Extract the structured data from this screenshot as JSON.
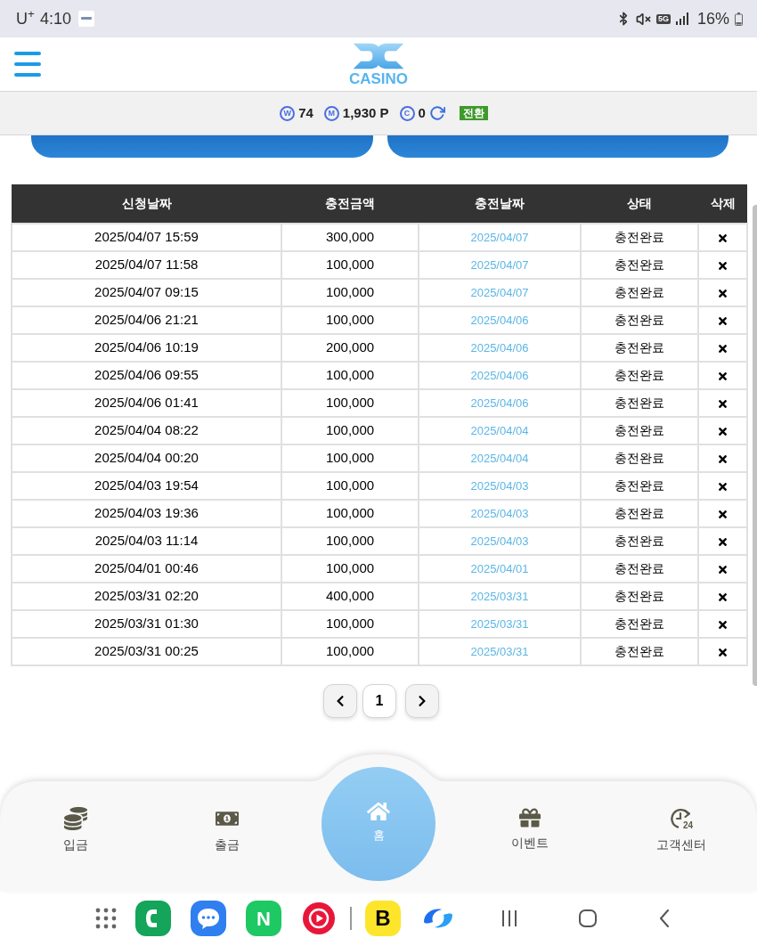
{
  "status_bar": {
    "carrier": "U$^{+}$",
    "time": "4:10",
    "network": "5G",
    "battery": "16%"
  },
  "header": {
    "logo_text": "CASINO"
  },
  "balance_bar": {
    "items": [
      {
        "symbol": "W",
        "value": "74"
      },
      {
        "symbol": "M",
        "value": "1,930 P"
      },
      {
        "symbol": "C",
        "value": "0"
      }
    ],
    "convert_button": "전환"
  },
  "table": {
    "columns": [
      "신청날짜",
      "충전금액",
      "충전날짜",
      "상태",
      "삭제"
    ],
    "rows": [
      {
        "requested": "2025/04/07 15:59",
        "amount": "300,000",
        "charged": "2025/04/07",
        "status": "충전완료"
      },
      {
        "requested": "2025/04/07 11:58",
        "amount": "100,000",
        "charged": "2025/04/07",
        "status": "충전완료"
      },
      {
        "requested": "2025/04/07 09:15",
        "amount": "100,000",
        "charged": "2025/04/07",
        "status": "충전완료"
      },
      {
        "requested": "2025/04/06 21:21",
        "amount": "100,000",
        "charged": "2025/04/06",
        "status": "충전완료"
      },
      {
        "requested": "2025/04/06 10:19",
        "amount": "200,000",
        "charged": "2025/04/06",
        "status": "충전완료"
      },
      {
        "requested": "2025/04/06 09:55",
        "amount": "100,000",
        "charged": "2025/04/06",
        "status": "충전완료"
      },
      {
        "requested": "2025/04/06 01:41",
        "amount": "100,000",
        "charged": "2025/04/06",
        "status": "충전완료"
      },
      {
        "requested": "2025/04/04 08:22",
        "amount": "100,000",
        "charged": "2025/04/04",
        "status": "충전완료"
      },
      {
        "requested": "2025/04/04 00:20",
        "amount": "100,000",
        "charged": "2025/04/04",
        "status": "충전완료"
      },
      {
        "requested": "2025/04/03 19:54",
        "amount": "100,000",
        "charged": "2025/04/03",
        "status": "충전완료"
      },
      {
        "requested": "2025/04/03 19:36",
        "amount": "100,000",
        "charged": "2025/04/03",
        "status": "충전완료"
      },
      {
        "requested": "2025/04/03 11:14",
        "amount": "100,000",
        "charged": "2025/04/03",
        "status": "충전완료"
      },
      {
        "requested": "2025/04/01 00:46",
        "amount": "100,000",
        "charged": "2025/04/01",
        "status": "충전완료"
      },
      {
        "requested": "2025/03/31 02:20",
        "amount": "400,000",
        "charged": "2025/03/31",
        "status": "충전완료"
      },
      {
        "requested": "2025/03/31 01:30",
        "amount": "100,000",
        "charged": "2025/03/31",
        "status": "충전완료"
      },
      {
        "requested": "2025/03/31 00:25",
        "amount": "100,000",
        "charged": "2025/03/31",
        "status": "충전완료"
      }
    ]
  },
  "pagination": {
    "pages": [
      "1"
    ]
  },
  "bottom_nav": {
    "items": [
      {
        "label": "입금",
        "kind": "tab"
      },
      {
        "label": "출금",
        "kind": "tab"
      },
      {
        "label": "홈",
        "kind": "center"
      },
      {
        "label": "이벤트",
        "kind": "tab"
      },
      {
        "label": "고객센터",
        "kind": "tab",
        "icon_text": "24"
      }
    ]
  },
  "dock": {
    "letters": [
      "N",
      "B"
    ]
  }
}
